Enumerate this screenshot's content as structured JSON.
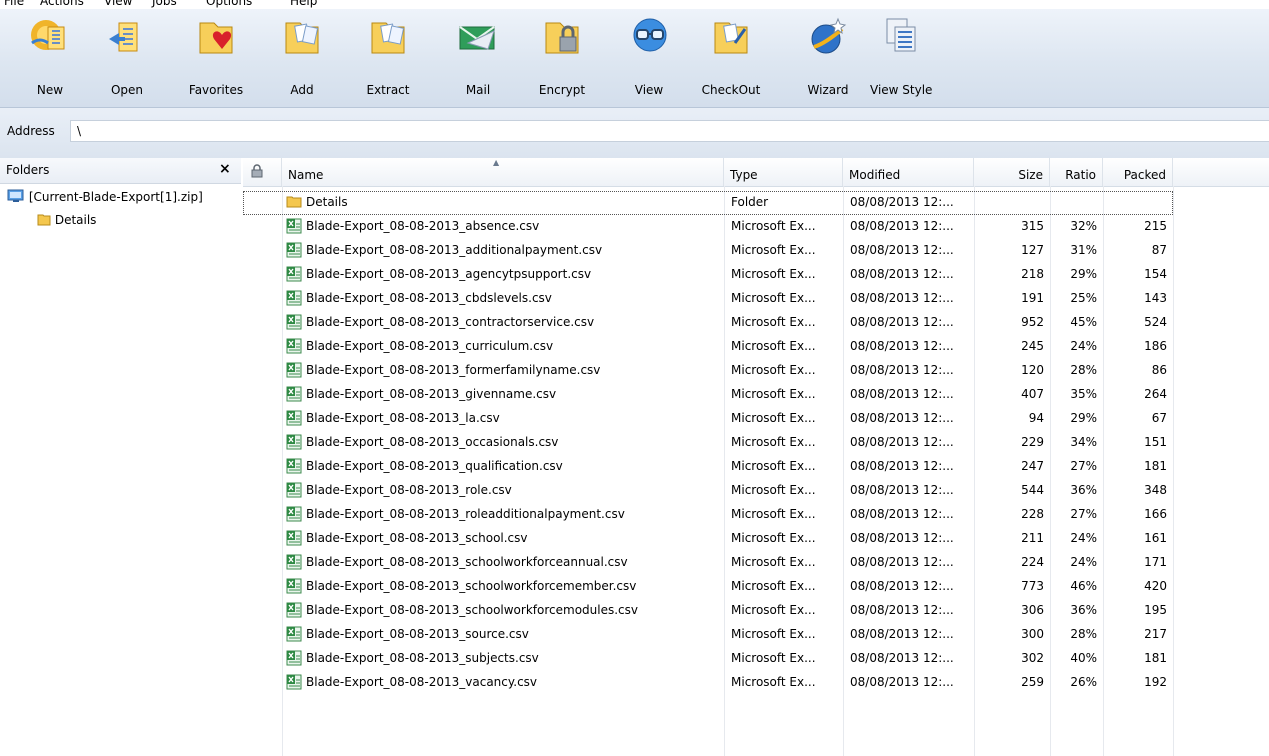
{
  "menu": [
    "File",
    "Actions",
    "View",
    "Jobs",
    "Options",
    "Help"
  ],
  "toolbar": [
    {
      "label": "New",
      "icon": "new-icon"
    },
    {
      "label": "Open",
      "icon": "open-icon"
    },
    {
      "label": "Favorites",
      "icon": "favorites-icon"
    },
    {
      "label": "Add",
      "icon": "add-icon"
    },
    {
      "label": "Extract",
      "icon": "extract-icon"
    },
    {
      "label": "Mail",
      "icon": "mail-icon"
    },
    {
      "label": "Encrypt",
      "icon": "encrypt-icon"
    },
    {
      "label": "View",
      "icon": "view-icon"
    },
    {
      "label": "CheckOut",
      "icon": "checkout-icon"
    },
    {
      "label": "Wizard",
      "icon": "wizard-icon"
    },
    {
      "label": "View Style",
      "icon": "view-style-icon"
    }
  ],
  "address": {
    "label": "Address",
    "value": "\\"
  },
  "folders": {
    "title": "Folders",
    "close": "×",
    "tree": [
      {
        "label": "[Current-Blade-Export[1].zip]",
        "icon": "zip-archive-icon"
      },
      {
        "label": "Details",
        "icon": "folder-icon"
      }
    ]
  },
  "columns": {
    "attr": "",
    "name": "Name",
    "type": "Type",
    "modified": "Modified",
    "size": "Size",
    "ratio": "Ratio",
    "packed": "Packed"
  },
  "files": [
    {
      "name": "Details",
      "type": "Folder",
      "modified": "08/08/2013 12:...",
      "size": "",
      "ratio": "",
      "packed": "",
      "icon": "folder-icon"
    },
    {
      "name": "Blade-Export_08-08-2013_absence.csv",
      "type": "Microsoft Ex...",
      "modified": "08/08/2013 12:...",
      "size": "315",
      "ratio": "32%",
      "packed": "215",
      "icon": "excel-csv-icon"
    },
    {
      "name": "Blade-Export_08-08-2013_additionalpayment.csv",
      "type": "Microsoft Ex...",
      "modified": "08/08/2013 12:...",
      "size": "127",
      "ratio": "31%",
      "packed": "87",
      "icon": "excel-csv-icon"
    },
    {
      "name": "Blade-Export_08-08-2013_agencytpsupport.csv",
      "type": "Microsoft Ex...",
      "modified": "08/08/2013 12:...",
      "size": "218",
      "ratio": "29%",
      "packed": "154",
      "icon": "excel-csv-icon"
    },
    {
      "name": "Blade-Export_08-08-2013_cbdslevels.csv",
      "type": "Microsoft Ex...",
      "modified": "08/08/2013 12:...",
      "size": "191",
      "ratio": "25%",
      "packed": "143",
      "icon": "excel-csv-icon"
    },
    {
      "name": "Blade-Export_08-08-2013_contractorservice.csv",
      "type": "Microsoft Ex...",
      "modified": "08/08/2013 12:...",
      "size": "952",
      "ratio": "45%",
      "packed": "524",
      "icon": "excel-csv-icon"
    },
    {
      "name": "Blade-Export_08-08-2013_curriculum.csv",
      "type": "Microsoft Ex...",
      "modified": "08/08/2013 12:...",
      "size": "245",
      "ratio": "24%",
      "packed": "186",
      "icon": "excel-csv-icon"
    },
    {
      "name": "Blade-Export_08-08-2013_formerfamilyname.csv",
      "type": "Microsoft Ex...",
      "modified": "08/08/2013 12:...",
      "size": "120",
      "ratio": "28%",
      "packed": "86",
      "icon": "excel-csv-icon"
    },
    {
      "name": "Blade-Export_08-08-2013_givenname.csv",
      "type": "Microsoft Ex...",
      "modified": "08/08/2013 12:...",
      "size": "407",
      "ratio": "35%",
      "packed": "264",
      "icon": "excel-csv-icon"
    },
    {
      "name": "Blade-Export_08-08-2013_la.csv",
      "type": "Microsoft Ex...",
      "modified": "08/08/2013 12:...",
      "size": "94",
      "ratio": "29%",
      "packed": "67",
      "icon": "excel-csv-icon"
    },
    {
      "name": "Blade-Export_08-08-2013_occasionals.csv",
      "type": "Microsoft Ex...",
      "modified": "08/08/2013 12:...",
      "size": "229",
      "ratio": "34%",
      "packed": "151",
      "icon": "excel-csv-icon"
    },
    {
      "name": "Blade-Export_08-08-2013_qualification.csv",
      "type": "Microsoft Ex...",
      "modified": "08/08/2013 12:...",
      "size": "247",
      "ratio": "27%",
      "packed": "181",
      "icon": "excel-csv-icon"
    },
    {
      "name": "Blade-Export_08-08-2013_role.csv",
      "type": "Microsoft Ex...",
      "modified": "08/08/2013 12:...",
      "size": "544",
      "ratio": "36%",
      "packed": "348",
      "icon": "excel-csv-icon"
    },
    {
      "name": "Blade-Export_08-08-2013_roleadditionalpayment.csv",
      "type": "Microsoft Ex...",
      "modified": "08/08/2013 12:...",
      "size": "228",
      "ratio": "27%",
      "packed": "166",
      "icon": "excel-csv-icon"
    },
    {
      "name": "Blade-Export_08-08-2013_school.csv",
      "type": "Microsoft Ex...",
      "modified": "08/08/2013 12:...",
      "size": "211",
      "ratio": "24%",
      "packed": "161",
      "icon": "excel-csv-icon"
    },
    {
      "name": "Blade-Export_08-08-2013_schoolworkforceannual.csv",
      "type": "Microsoft Ex...",
      "modified": "08/08/2013 12:...",
      "size": "224",
      "ratio": "24%",
      "packed": "171",
      "icon": "excel-csv-icon"
    },
    {
      "name": "Blade-Export_08-08-2013_schoolworkforcemember.csv",
      "type": "Microsoft Ex...",
      "modified": "08/08/2013 12:...",
      "size": "773",
      "ratio": "46%",
      "packed": "420",
      "icon": "excel-csv-icon"
    },
    {
      "name": "Blade-Export_08-08-2013_schoolworkforcemodules.csv",
      "type": "Microsoft Ex...",
      "modified": "08/08/2013 12:...",
      "size": "306",
      "ratio": "36%",
      "packed": "195",
      "icon": "excel-csv-icon"
    },
    {
      "name": "Blade-Export_08-08-2013_source.csv",
      "type": "Microsoft Ex...",
      "modified": "08/08/2013 12:...",
      "size": "300",
      "ratio": "28%",
      "packed": "217",
      "icon": "excel-csv-icon"
    },
    {
      "name": "Blade-Export_08-08-2013_subjects.csv",
      "type": "Microsoft Ex...",
      "modified": "08/08/2013 12:...",
      "size": "302",
      "ratio": "40%",
      "packed": "181",
      "icon": "excel-csv-icon"
    },
    {
      "name": "Blade-Export_08-08-2013_vacancy.csv",
      "type": "Microsoft Ex...",
      "modified": "08/08/2013 12:...",
      "size": "259",
      "ratio": "26%",
      "packed": "192",
      "icon": "excel-csv-icon"
    }
  ]
}
